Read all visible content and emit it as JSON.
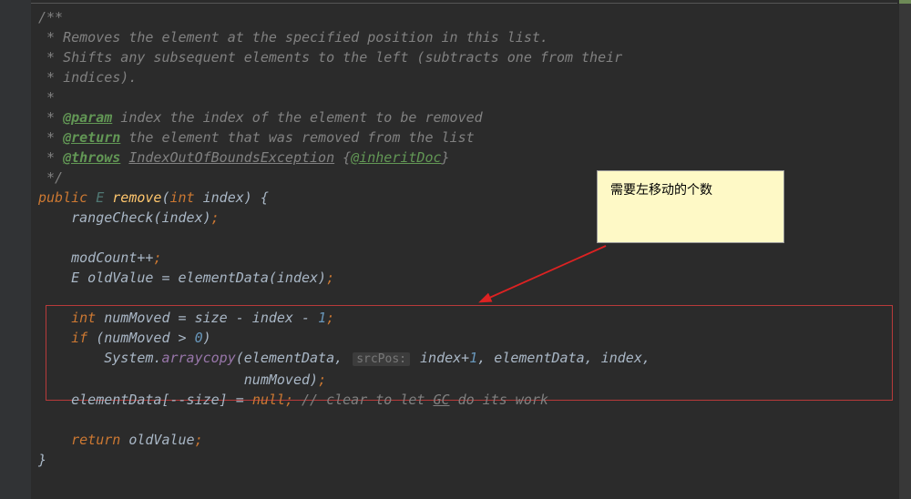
{
  "code": {
    "javadoc": {
      "open": "/**",
      "l1": " * Removes the element at the specified position in this list.",
      "l2": " * Shifts any subsequent elements to the left (subtracts one from their",
      "l3": " * indices).",
      "l4": " *",
      "param_tag": "@param",
      "param_rest": " index the index of the element to be removed",
      "return_tag": "@return",
      "return_rest": " the element that was removed from the list",
      "throws_tag": "@throws",
      "throws_link": "IndexOutOfBoundsException",
      "inherit_tag": "@inheritDoc",
      "close": " */",
      "star": " * "
    },
    "sig": {
      "public": "public",
      "E": "E",
      "remove": "remove",
      "int": "int",
      "index": "index"
    },
    "body": {
      "rangeCheck": "rangeCheck(index)",
      "modcount": "modCount++",
      "decl_old": "E oldValue = elementData(index)",
      "int_kw": "int",
      "numMoved": "numMoved",
      "eq_size": " = size - index - ",
      "one": "1",
      "if_kw": "if",
      "cond": " (numMoved > ",
      "zero": "0",
      "system": "System.",
      "arraycopy": "arraycopy",
      "ac_args1": "(elementData, ",
      "srcpos_hint": "srcPos:",
      "ac_args1b": " index+",
      "ac_args2": ", elementData, index,",
      "ac_args3": "numMoved)",
      "eldata_line": "elementData[--size] = ",
      "null_kw": "null",
      "cmt_prefix": "// clear to let ",
      "cmt_gc": "GC",
      "cmt_suffix": " do its work",
      "return_kw": "return",
      "return_val": " oldValue"
    },
    "semi": ";"
  },
  "note_text": "需要左移动的个数"
}
